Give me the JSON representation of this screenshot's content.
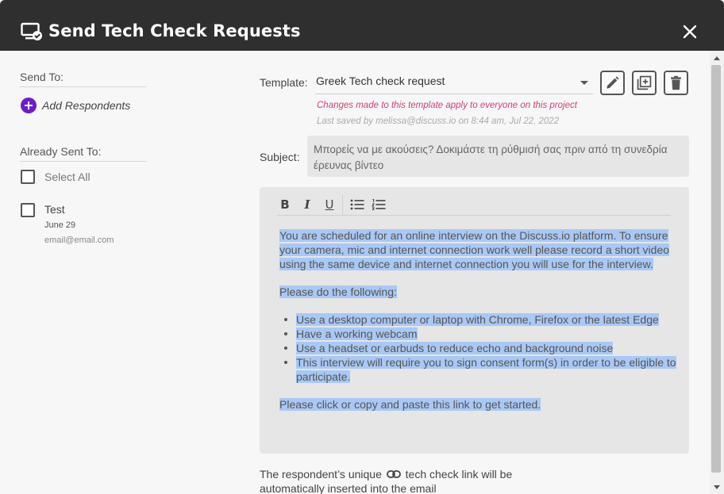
{
  "header": {
    "title": "Send Tech Check Requests",
    "icon": "monitor-check-icon",
    "close_icon": "close-icon"
  },
  "left": {
    "send_to_label": "Send To:",
    "add_respondents_label": "Add Respondents",
    "already_sent_label": "Already Sent To:",
    "select_all_label": "Select All",
    "respondents": [
      {
        "name": "Test",
        "date": "June 29",
        "email": "email@email.com"
      }
    ]
  },
  "template": {
    "label": "Template:",
    "selected": "Greek Tech check request",
    "warning": "Changes made to this template apply to everyone on this project",
    "last_saved": "Last saved by melissa@discuss.io on 8:44 am, Jul 22, 2022",
    "actions": [
      "pencil-icon",
      "duplicate-icon",
      "trash-icon"
    ]
  },
  "subject": {
    "label": "Subject:",
    "value": "Μπορείς να με ακούσεις? Δοκιμάστε τη ρύθμισή σας πριν από τη συνεδρία έρευνας βίντεο"
  },
  "editor": {
    "toolbar": {
      "bold": "B",
      "italic": "I",
      "underline": "U"
    },
    "intro": "You are scheduled for an online interview on the Discuss.io platform. To ensure your camera, mic and internet connection work well please record a short video using the same device and internet connection you will use for the interview.",
    "instructions_heading": "Please do the following:",
    "bullets": [
      "Use a desktop computer or laptop with Chrome, Firefox or the latest Edge",
      "Have a working webcam",
      "Use a headset or earbuds to reduce echo and background noise",
      "This interview will require you to sign consent form(s) in order to be eligible to participate."
    ],
    "closing": "Please click or copy and paste this link to get started."
  },
  "footer": {
    "note_before": "The respondent’s unique",
    "note_after": "tech check link will be automatically inserted into the email"
  },
  "colors": {
    "header_bg": "#2f2f2f",
    "accent_purple": "#6d1fc4",
    "warning_pink": "#cf3f7a",
    "selection_blue": "#a9c8f5"
  }
}
